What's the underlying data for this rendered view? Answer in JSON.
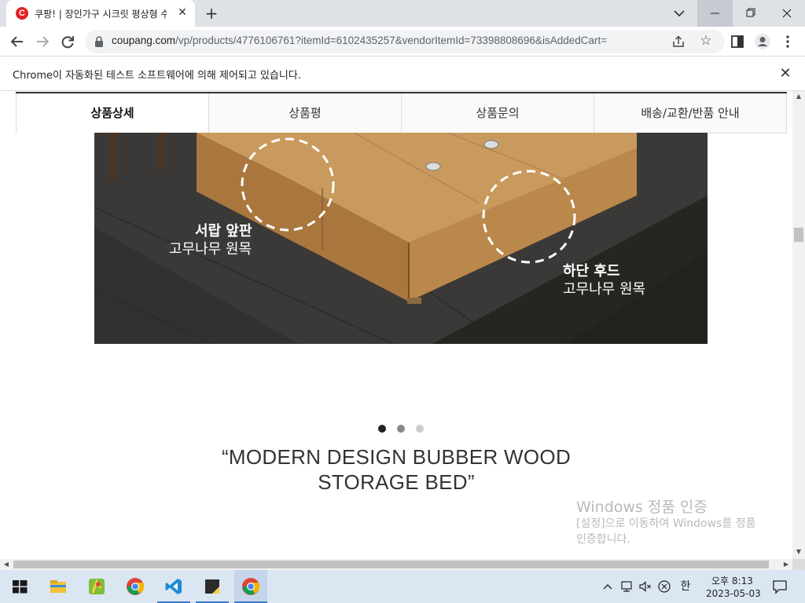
{
  "browser": {
    "tab_title": "쿠팡! | 장인가구 시크릿 평상형 수납 침대",
    "tab_favicon_letter": "C",
    "url_domain": "coupang.com",
    "url_path": "/vp/products/4776106761?itemId=6102435257&vendorItemId=73398808696&isAddedCart=",
    "infobar_text": "Chrome이 자동화된 테스트 소프트웨어에 의해 제어되고 있습니다."
  },
  "product_tabs": [
    "상품상세",
    "상품평",
    "상품문의",
    "배송/교환/반품 안내"
  ],
  "active_tab_index": 0,
  "product_image": {
    "label1_title": "서랍 앞판",
    "label1_sub": "고무나무 원목",
    "label2_title": "하단 후드",
    "label2_sub": "고무나무 원목"
  },
  "carousel": {
    "total": 3,
    "active_index": 0
  },
  "headline": {
    "line1": "“MODERN DESIGN BUBBER WOOD",
    "line2": "STORAGE BED”"
  },
  "watermark": {
    "title": "Windows 정품 인증",
    "line1": "[설정]으로 이동하여 Windows를 정품",
    "line2": "인증합니다."
  },
  "taskbar": {
    "apps": [
      "file-explorer",
      "map-app",
      "chrome",
      "vscode",
      "sticky-notes",
      "chrome-active"
    ],
    "ime": "한",
    "time": "오후 8:13",
    "date": "2023-05-03"
  },
  "colors": {
    "brand_red": "#e02020",
    "taskbar": "#dbe6f3",
    "wood": "#c7955a"
  }
}
